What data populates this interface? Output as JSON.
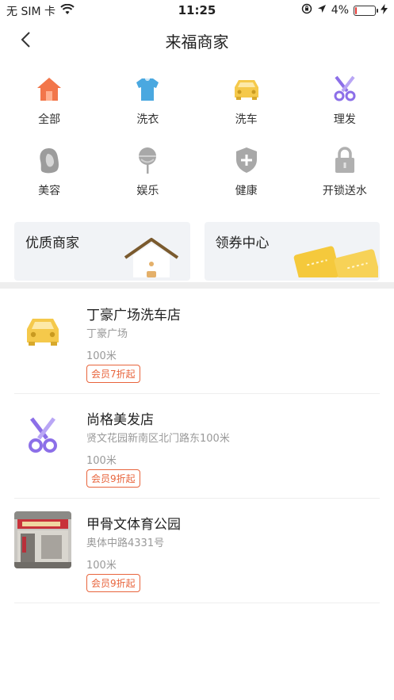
{
  "status_bar": {
    "carrier": "无 SIM 卡",
    "time": "11:25",
    "battery": "4%",
    "battery_level": 0.04
  },
  "nav": {
    "title": "来福商家"
  },
  "categories": [
    {
      "label": "全部",
      "icon": "home-icon",
      "color": "#f2764a"
    },
    {
      "label": "洗衣",
      "icon": "shirt-icon",
      "color": "#4aa8e0"
    },
    {
      "label": "洗车",
      "icon": "car-icon",
      "color": "#f5c94b"
    },
    {
      "label": "理发",
      "icon": "scissors-icon",
      "color": "#8c6fe8"
    },
    {
      "label": "美容",
      "icon": "face-icon",
      "color": "#9c9c9c"
    },
    {
      "label": "娱乐",
      "icon": "lollipop-icon",
      "color": "#a8a8a8"
    },
    {
      "label": "健康",
      "icon": "shield-plus-icon",
      "color": "#a8a8a8"
    },
    {
      "label": "开锁送水",
      "icon": "lock-icon",
      "color": "#b0b0b0"
    }
  ],
  "banners": [
    {
      "label": "优质商家",
      "icon": "house-icon"
    },
    {
      "label": "领券中心",
      "icon": "coupon-icon"
    }
  ],
  "merchants": [
    {
      "name": "丁豪广场洗车店",
      "address": "丁豪广场",
      "distance": "100米",
      "badge": "会员7折起",
      "icon": "car-icon"
    },
    {
      "name": "尚格美发店",
      "address": "贤文花园新南区北门路东100米",
      "distance": "100米",
      "badge": "会员9折起",
      "icon": "scissors-icon"
    },
    {
      "name": "甲骨文体育公园",
      "address": "奥体中路4331号",
      "distance": "100米",
      "badge": "会员9折起",
      "icon": "storefront-photo"
    }
  ]
}
